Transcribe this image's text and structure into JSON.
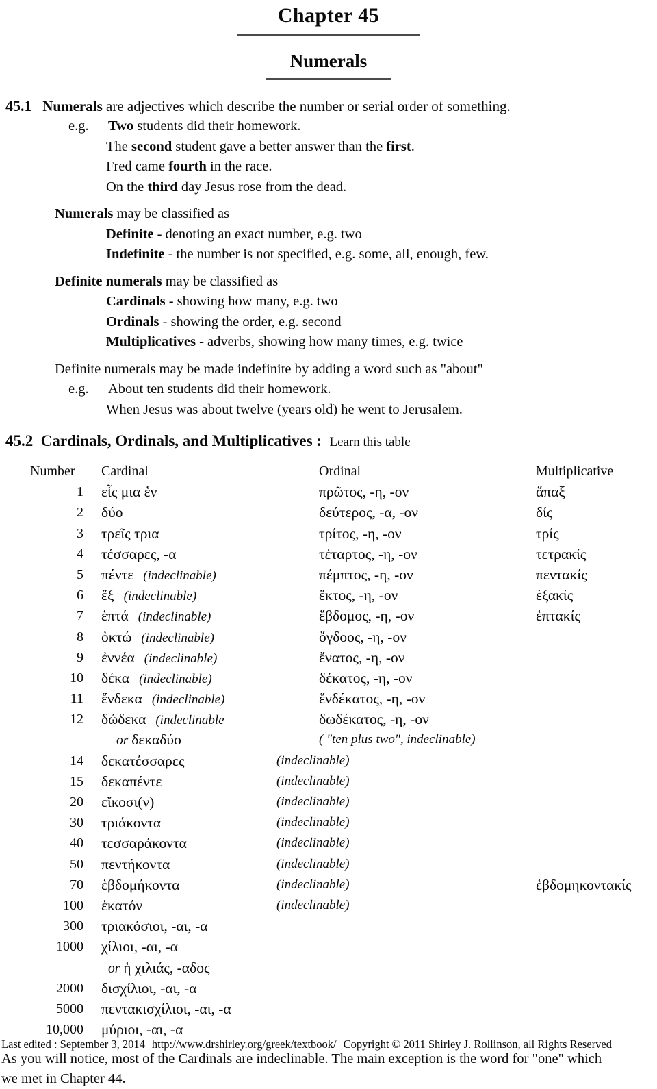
{
  "header": {
    "chapter_title": "Chapter  45",
    "doc_title": "Numerals"
  },
  "section_45_1": {
    "number": "45.1",
    "lead_bold": "Numerals",
    "lead_rest": " are adjectives which describe the number or serial order of something.",
    "eg_label": "e.g.",
    "examples": [
      {
        "bold": "Two",
        "before": "",
        "after": " students did their homework."
      },
      {
        "before": "The ",
        "bold": "second",
        "after": " student gave a better answer than the ",
        "bold2": "first",
        "after2": "."
      },
      {
        "before": "Fred came ",
        "bold": "fourth",
        "after": " in the race."
      },
      {
        "before": "On the ",
        "bold": "third",
        "after": " day Jesus rose from the dead."
      }
    ],
    "classify_bold": "Numerals",
    "classify_rest": " may be classified as",
    "classify_items": [
      {
        "bold": "Definite",
        "rest": " - denoting an exact number, e.g. two"
      },
      {
        "bold": "Indefinite",
        "rest": " - the number is not specified, e.g. some, all, enough, few."
      }
    ],
    "definite_bold": "Definite numerals",
    "definite_rest": " may be classified as",
    "definite_items": [
      {
        "bold": "Cardinals",
        "rest": " - showing how many,   e.g. two"
      },
      {
        "bold": "Ordinals",
        "rest": " - showing the order,  e.g. second"
      },
      {
        "bold": "Multiplicatives",
        "rest": " - adverbs, showing how many times,  e.g. twice"
      }
    ],
    "about_line": "Definite numerals may be made indefinite by adding a word such as \"about\"",
    "about_examples": [
      "About ten students did their homework.",
      "When Jesus was about twelve (years old) he went to Jerusalem."
    ]
  },
  "section_45_2": {
    "number": "45.2",
    "title": "Cardinals,  Ordinals,  and Multiplicatives  :",
    "subtitle": "Learn this table",
    "columns": {
      "number": "Number",
      "cardinal": "Cardinal",
      "ordinal": "Ordinal",
      "multiplicative": "Multiplicative"
    },
    "indeclinable_label": "(indeclinable)",
    "or_label": "or",
    "rows": [
      {
        "number": "1",
        "cardinal": "εἷς  μια  ἑν",
        "cardinal_note": "",
        "ordinal": "πρῶτος, -η, -ον",
        "ordinal_note": "",
        "multiplicative": "ἅπαξ"
      },
      {
        "number": "2",
        "cardinal": "δύο",
        "cardinal_note": "",
        "ordinal": "δεύτερος, -α, -ον",
        "ordinal_note": "",
        "multiplicative": "δίς"
      },
      {
        "number": "3",
        "cardinal": "τρεῖς  τρια",
        "cardinal_note": "",
        "ordinal": "τρίτος, -η, -ον",
        "ordinal_note": "",
        "multiplicative": "τρίς"
      },
      {
        "number": "4",
        "cardinal": "τέσσαρες, -α",
        "cardinal_note": "",
        "ordinal": "τέταρτος, -η, -ον",
        "ordinal_note": "",
        "multiplicative": "τετρακίς"
      },
      {
        "number": "5",
        "cardinal": "πέντε",
        "cardinal_note": "(indeclinable)",
        "ordinal": "πέμπτος, -η, -ον",
        "ordinal_note": "",
        "multiplicative": "πεντακίς"
      },
      {
        "number": "6",
        "cardinal": "ἕξ",
        "cardinal_note": "(indeclinable)",
        "ordinal": "ἕκτος, -η, -ον",
        "ordinal_note": "",
        "multiplicative": "ἑξακίς"
      },
      {
        "number": "7",
        "cardinal": "ἑπτά",
        "cardinal_note": "(indeclinable)",
        "ordinal": "ἕβδομος, -η, -ον",
        "ordinal_note": "",
        "multiplicative": "ἑπτακίς"
      },
      {
        "number": "8",
        "cardinal": "ὀκτώ",
        "cardinal_note": "(indeclinable)",
        "ordinal": "ὄγδοος, -η, -ον",
        "ordinal_note": "",
        "multiplicative": ""
      },
      {
        "number": "9",
        "cardinal": "ἐννέα",
        "cardinal_note": "(indeclinable)",
        "ordinal": "ἔνατος, -η, -ον",
        "ordinal_note": "",
        "multiplicative": ""
      },
      {
        "number": "10",
        "cardinal": "δέκα",
        "cardinal_note": "(indeclinable)",
        "ordinal": "δέκατος, -η, -ον",
        "ordinal_note": "",
        "multiplicative": ""
      },
      {
        "number": "11",
        "cardinal": "ἕνδεκα",
        "cardinal_note": "(indeclinable)",
        "ordinal": "ἕνδέκατος, -η, -ον",
        "ordinal_note": "",
        "multiplicative": ""
      },
      {
        "number": "12",
        "cardinal": "δώδεκα",
        "cardinal_note": "(indeclinable",
        "ordinal": "δωδέκατος, -η, -ον",
        "ordinal_note": "",
        "multiplicative": ""
      },
      {
        "number": "",
        "cardinal": "δεκαδύο",
        "cardinal_note": "",
        "ordinal": "",
        "ordinal_note": "( \"ten plus two\", indeclinable)",
        "multiplicative": "",
        "or_prefix": true
      },
      {
        "number": "14",
        "cardinal": "δεκατέσσαρες",
        "cardinal_note": "",
        "ordinal": "",
        "ordinal_note": "(indeclinable)",
        "multiplicative": ""
      },
      {
        "number": "15",
        "cardinal": "δεκαπέντε",
        "cardinal_note": "",
        "ordinal": "",
        "ordinal_note": "(indeclinable)",
        "multiplicative": ""
      },
      {
        "number": "20",
        "cardinal": "εἴκοσι(ν)",
        "cardinal_note": "",
        "ordinal": "",
        "ordinal_note": "(indeclinable)",
        "multiplicative": ""
      },
      {
        "number": "30",
        "cardinal": "τριάκοντα",
        "cardinal_note": "",
        "ordinal": "",
        "ordinal_note": "(indeclinable)",
        "multiplicative": ""
      },
      {
        "number": "40",
        "cardinal": "τεσσαράκοντα",
        "cardinal_note": "",
        "ordinal": "",
        "ordinal_note": "(indeclinable)",
        "multiplicative": ""
      },
      {
        "number": "50",
        "cardinal": "πεντήκοντα",
        "cardinal_note": "",
        "ordinal": "",
        "ordinal_note": "(indeclinable)",
        "multiplicative": ""
      },
      {
        "number": "70",
        "cardinal": "ἑβδομήκοντα",
        "cardinal_note": "",
        "ordinal": "",
        "ordinal_note": "(indeclinable)",
        "multiplicative": "ἑβδομηκοντακίς"
      },
      {
        "number": "100",
        "cardinal": "ἑκατόν",
        "cardinal_note": "",
        "ordinal": "",
        "ordinal_note": "(indeclinable)",
        "multiplicative": ""
      },
      {
        "number": "300",
        "cardinal": "τριακόσιοι, -αι, -α",
        "cardinal_note": "",
        "ordinal": "",
        "ordinal_note": "",
        "multiplicative": ""
      },
      {
        "number": "1000",
        "cardinal": "χίλιοι, -αι, -α",
        "cardinal_note": "",
        "ordinal": "",
        "ordinal_note": "",
        "multiplicative": ""
      },
      {
        "number": "",
        "cardinal": "ἡ  χιλιάς, -αδος",
        "cardinal_note": "",
        "ordinal": "",
        "ordinal_note": "",
        "multiplicative": "",
        "or_prefix": true
      },
      {
        "number": "2000",
        "cardinal": "δισχίλιοι, -αι, -α",
        "cardinal_note": "",
        "ordinal": "",
        "ordinal_note": "",
        "multiplicative": ""
      },
      {
        "number": "5000",
        "cardinal": "πεντακισχίλιοι, -αι, -α",
        "cardinal_note": "",
        "ordinal": "",
        "ordinal_note": "",
        "multiplicative": ""
      },
      {
        "number": "10,000",
        "cardinal": "μύριοι, -αι, -α",
        "cardinal_note": "",
        "ordinal": "",
        "ordinal_note": "",
        "multiplicative": ""
      }
    ]
  },
  "closing": {
    "line1": "As you will notice, most of the Cardinals are indeclinable. The main exception is the word for \"one\" which",
    "line2": "we met in Chapter 44."
  },
  "footer": {
    "last_edited": "Last edited : September 3, 2014",
    "url": "http://www.drshirley.org/greek/textbook/",
    "copyright": "Copyright © 2011 Shirley J. Rollinson, all Rights Reserved"
  }
}
